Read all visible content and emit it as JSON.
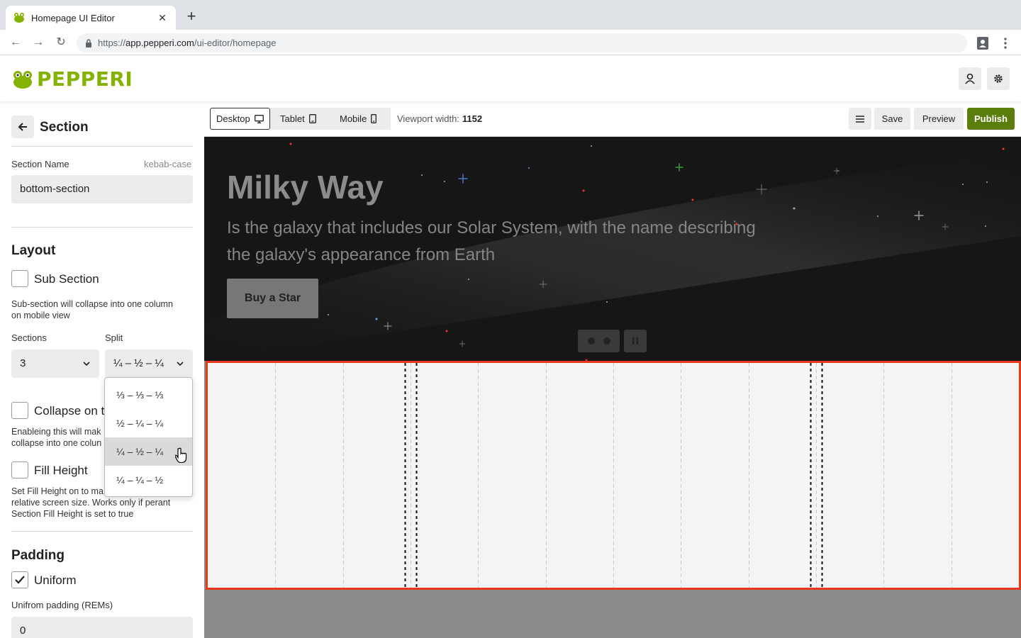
{
  "browser": {
    "tab_title": "Homepage UI Editor",
    "url_scheme": "https://",
    "url_host": "app.pepperi.com",
    "url_path": "/ui-editor/homepage"
  },
  "app": {
    "logo_text": "PEPPERI",
    "brand_color": "#83b300"
  },
  "panel": {
    "title": "Section",
    "section_name_label": "Section Name",
    "section_name_hint": "kebab-case",
    "section_name_value": "bottom-section",
    "layout_heading": "Layout",
    "sub_section_label": "Sub Section",
    "sub_section_checked": false,
    "sub_section_desc_1": "Sub-section will collapse into one column",
    "sub_section_desc_2": "on mobile view",
    "sections_label": "Sections",
    "sections_value": "3",
    "split_label": "Split",
    "split_value": "¼ – ½ – ¼",
    "collapse_label": "Collapse on t",
    "collapse_desc_1": "Enableing this will mak",
    "collapse_desc_2": "collapse into one colun",
    "fill_height_label": "Fill Height",
    "fill_height_desc_1": "Set Fill Height on to ma",
    "fill_height_desc_2": "relative screen size. Works only if perant",
    "fill_height_desc_3": "Section Fill Height is set to true",
    "padding_heading": "Padding",
    "uniform_label": "Uniform",
    "uniform_checked": true,
    "uniform_padding_label": "Unifrom padding (REMs)",
    "uniform_padding_value": "0",
    "split_options": [
      "⅓ – ⅓ – ⅓",
      "½ – ¼ – ¼",
      "¼ – ½ – ¼",
      "¼ – ¼ – ½"
    ],
    "split_hovered_index": 2
  },
  "editor_toolbar": {
    "desktop": "Desktop",
    "tablet": "Tablet",
    "mobile": "Mobile",
    "viewport_label": "Viewport width:",
    "viewport_value": "1152",
    "save": "Save",
    "preview": "Preview",
    "publish": "Publish",
    "publish_color": "#5a7d0c"
  },
  "hero": {
    "title": "Milky Way",
    "subtitle": "Is the galaxy that includes our Solar System, with the name describing the galaxy's appearance from Earth",
    "button": "Buy a Star"
  },
  "section": {
    "border_color": "#e53a1e",
    "split": [
      0.25,
      0.5,
      0.25
    ],
    "grid_columns": 12
  }
}
